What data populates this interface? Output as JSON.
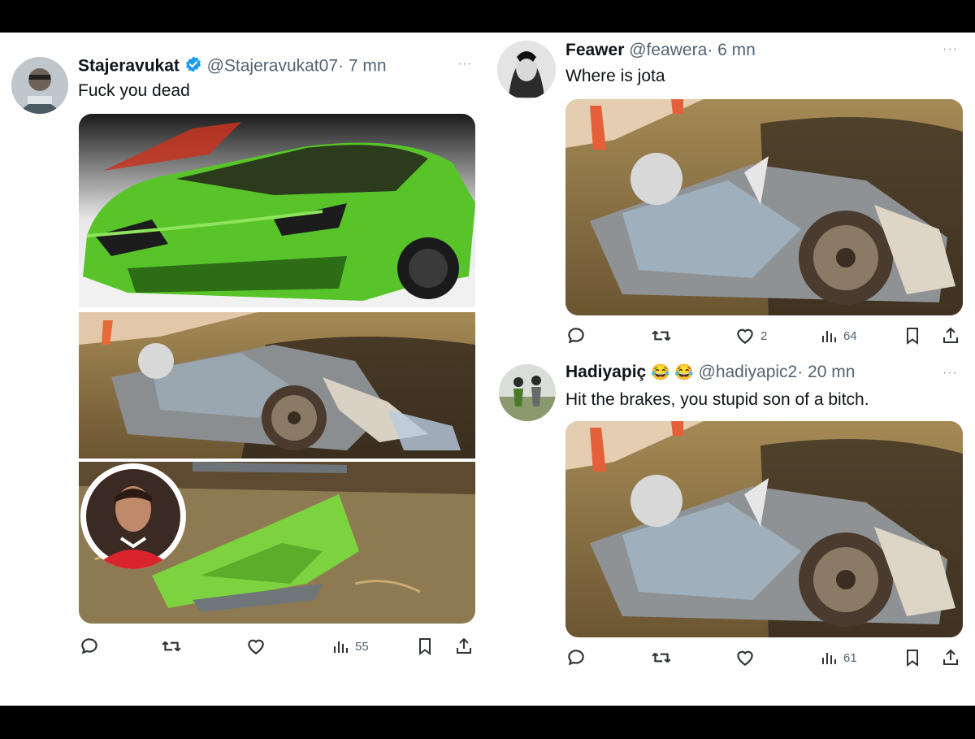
{
  "tweets": [
    {
      "username": "Stajeravukat",
      "handle": "@Stajeravukat07",
      "time": "· 7 mn",
      "text": "Fuck you dead",
      "verified": true,
      "more": "···",
      "views": "55",
      "likes": "",
      "media": [
        "green-sports-car",
        "crashed-car-wreckage",
        "green-car-debris",
        "player-portrait"
      ]
    },
    {
      "username": "Feawer",
      "handle": "@feawera",
      "time": "· 6 mn",
      "text": "Where is jota",
      "more": "···",
      "likes": "2",
      "views": "64",
      "media": [
        "crashed-car-wreckage"
      ]
    },
    {
      "username": "Hadiyapiç",
      "emoji": "😂 😂",
      "handle": "@hadiyapic2",
      "time": "· 20 mn",
      "text": "Hit the brakes, you stupid son of a bitch.",
      "more": "···",
      "likes": "",
      "views": "61",
      "media": [
        "crashed-car-wreckage"
      ]
    }
  ],
  "colors": {
    "background": "#000000",
    "panel": "#ffffff",
    "verified": "#1d9bf0",
    "secondary_text": "#536471",
    "car_green": "#5fd22a"
  },
  "icons": [
    "reply-icon",
    "retweet-icon",
    "like-icon",
    "views-icon",
    "bookmark-icon",
    "share-icon",
    "verified-badge-icon",
    "more-icon"
  ]
}
